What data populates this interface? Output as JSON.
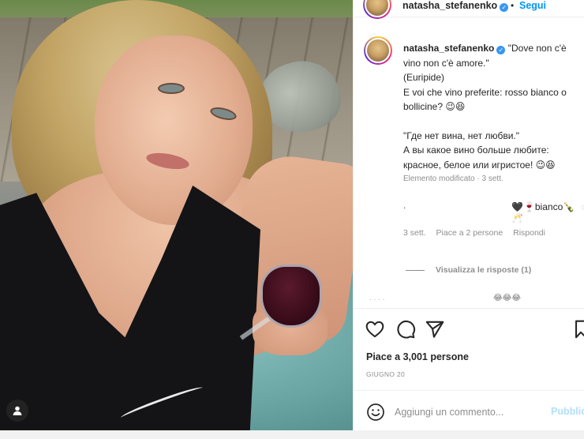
{
  "post": {
    "username": "natasha_stefanenko",
    "follow_label": "Segui",
    "separator": "•"
  },
  "caption": {
    "username": "natasha_stefanenko",
    "lines_it": [
      "\"Dove non c'è",
      "vino non c'è amore.\"",
      "(Euripide)",
      "E voi che vino preferite: rosso bianco o",
      "bollicine? 😉😆"
    ],
    "lines_ru": [
      "\"Где нет вина, нет любви.\"",
      "А вы какое вино больше любите:",
      "красное, белое или игристое! 😉😆"
    ],
    "meta": "Elemento modificato · 3 sett."
  },
  "comment": {
    "dot": ".",
    "text": "🖤🍷bianco🍾🥂",
    "meta_time": "3 sett.",
    "meta_likes": "Piace a 2 persone",
    "meta_reply": "Rispondi"
  },
  "view_replies": "Visualizza le risposte (1)",
  "comment2": {
    "faint_text": ".  .                 .  .",
    "emoji": "😂😂😂"
  },
  "stats": {
    "likes": "Piace a 3,001 persone",
    "date": "GIUGNO 20"
  },
  "composer": {
    "placeholder": "Aggiungi un commento...",
    "post_label": "Pubblica"
  },
  "icons": {
    "like": "heart-icon",
    "comment": "comment-icon",
    "share": "send-icon",
    "save": "bookmark-icon",
    "emoji": "smiley-icon",
    "user_tag": "user-tag-icon"
  },
  "colors": {
    "link_blue": "#0095f6",
    "verified_blue": "#3897f0",
    "muted": "#8e8e8e",
    "post_disabled": "#b2dffc"
  }
}
